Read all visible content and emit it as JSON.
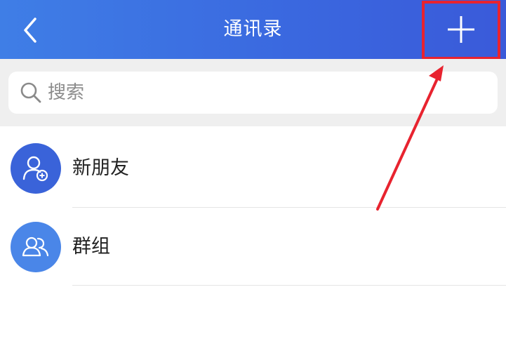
{
  "header": {
    "title": "通讯录",
    "back_icon": "chevron-left-icon",
    "add_icon": "plus-icon"
  },
  "search": {
    "placeholder": "搜索",
    "icon": "search-icon"
  },
  "list": [
    {
      "label": "新朋友",
      "icon": "new-friend-icon"
    },
    {
      "label": "群组",
      "icon": "group-icon"
    }
  ],
  "colors": {
    "header_left": "#3f7ee6",
    "header_right": "#3a5ad9",
    "avatar_new_friend": "#3a63d9",
    "avatar_group": "#4a86e8",
    "highlight": "#e8232f"
  }
}
